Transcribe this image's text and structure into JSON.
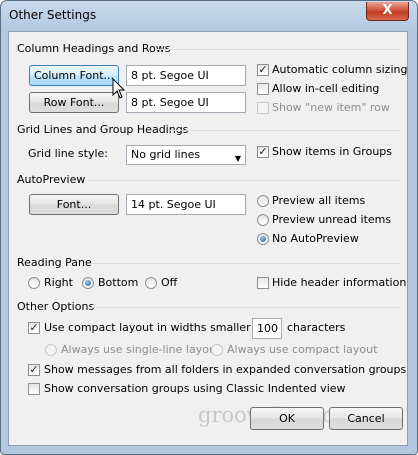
{
  "window": {
    "title": "Other Settings",
    "close_label": "X"
  },
  "column_headings": {
    "group_label": "Column Headings and Rows",
    "column_font_button": "Column Font...",
    "column_font_value": "8 pt. Segoe UI",
    "row_font_button": "Row Font...",
    "row_font_value": "8 pt. Segoe UI",
    "auto_column_sizing": "Automatic column sizing",
    "allow_in_cell_editing": "Allow in-cell editing",
    "show_new_item_row": "Show \"new item\" row"
  },
  "grid_lines": {
    "group_label": "Grid Lines and Group Headings",
    "grid_line_style_label": "Grid line style:",
    "grid_line_style_value": "No grid lines",
    "show_items_in_groups": "Show items in Groups"
  },
  "autopreview": {
    "group_label": "AutoPreview",
    "font_button": "Font...",
    "font_value": "14 pt. Segoe UI",
    "preview_all": "Preview all items",
    "preview_unread": "Preview unread items",
    "no_autopreview": "No AutoPreview"
  },
  "reading_pane": {
    "group_label": "Reading Pane",
    "right": "Right",
    "bottom": "Bottom",
    "off": "Off",
    "hide_header": "Hide header information"
  },
  "other_options": {
    "group_label": "Other Options",
    "compact_layout_prefix": "Use compact layout in widths smaller than",
    "compact_width_value": "100",
    "compact_layout_suffix": "characters",
    "always_single_line": "Always use single-line layout",
    "always_compact": "Always use compact layout",
    "show_all_folders": "Show messages from all folders in expanded conversation groups",
    "classic_indented": "Show conversation groups using Classic Indented view"
  },
  "footer": {
    "watermark": "groovyPost.com",
    "ok": "OK",
    "cancel": "Cancel"
  },
  "icons": {
    "check": "✓",
    "dropdown": "▼"
  }
}
